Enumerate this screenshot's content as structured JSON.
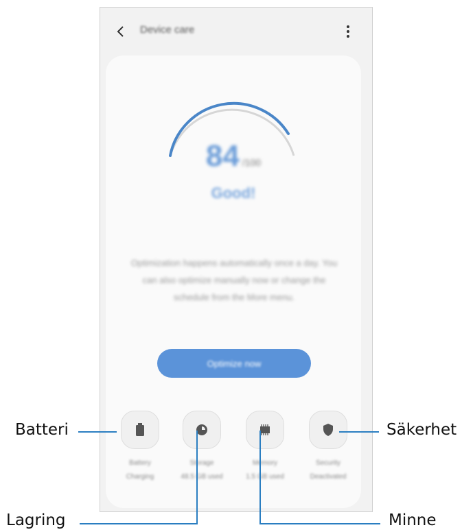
{
  "appbar": {
    "title": "Device care"
  },
  "score": {
    "value": "84",
    "max": "/100",
    "status": "Good!",
    "progress": 0.84
  },
  "description": "Optimization happens automatically once a day. You can also optimize manually now or change the schedule from the More menu.",
  "optimize_button": {
    "label": "Optimize now"
  },
  "features": [
    {
      "name": "Battery",
      "status": "Charging"
    },
    {
      "name": "Storage",
      "status": "48.5 GB used"
    },
    {
      "name": "Memory",
      "status": "1.5 GB used"
    },
    {
      "name": "Security",
      "status": "Deactivated"
    }
  ],
  "callouts": {
    "battery": "Batteri",
    "storage": "Lagring",
    "memory": "Minne",
    "security": "Säkerhet"
  },
  "colors": {
    "accent": "#5b93d9",
    "callout_line": "#2a7ec1",
    "gauge_track": "#d6d6d6"
  }
}
